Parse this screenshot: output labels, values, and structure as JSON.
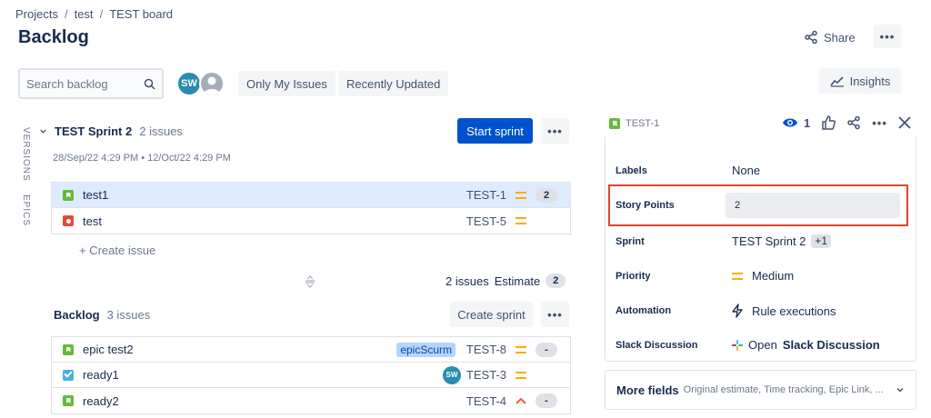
{
  "breadcrumb": [
    "Projects",
    "test",
    "TEST board"
  ],
  "page_title": "Backlog",
  "header": {
    "share_label": "Share",
    "more_label": "•••"
  },
  "toolbar": {
    "search_placeholder": "Search backlog",
    "avatar_initials": "SW",
    "filters": [
      "Only My Issues",
      "Recently Updated"
    ],
    "insights_label": "Insights"
  },
  "side_tabs": [
    "VERSIONS",
    "EPICS"
  ],
  "sprint": {
    "name": "TEST Sprint 2",
    "count": "2 issues",
    "dates": "28/Sep/22 4:29 PM • 12/Oct/22 4:29 PM",
    "start_label": "Start sprint",
    "issues": [
      {
        "summary": "test1",
        "key": "TEST-1",
        "type": "story",
        "priority": "medium",
        "estimate": "2",
        "selected": true
      },
      {
        "summary": "test",
        "key": "TEST-5",
        "type": "bug",
        "priority": "medium",
        "estimate": ""
      }
    ],
    "create_issue": "+ Create issue",
    "summary_count": "2 issues",
    "summary_estimate_label": "Estimate",
    "summary_estimate": "2"
  },
  "backlog": {
    "name": "Backlog",
    "count": "3 issues",
    "create_sprint_label": "Create sprint",
    "issues": [
      {
        "summary": "epic test2",
        "key": "TEST-8",
        "type": "story",
        "priority": "medium",
        "estimate": "-",
        "epic": "epicScurm"
      },
      {
        "summary": "ready1",
        "key": "TEST-3",
        "type": "task",
        "priority": "medium",
        "assignee": "SW"
      },
      {
        "summary": "ready2",
        "key": "TEST-4",
        "type": "story",
        "priority": "high",
        "estimate": "-"
      }
    ]
  },
  "detail": {
    "key": "TEST-1",
    "watchers": "1",
    "fields": {
      "labels": {
        "label": "Labels",
        "value": "None"
      },
      "story_points": {
        "label": "Story Points",
        "value": "2"
      },
      "sprint": {
        "label": "Sprint",
        "value": "TEST Sprint 2",
        "extra": "+1"
      },
      "priority": {
        "label": "Priority",
        "value": "Medium"
      },
      "automation": {
        "label": "Automation",
        "value": "Rule executions"
      },
      "slack": {
        "label": "Slack Discussion",
        "value_prefix": "Open",
        "value_strong": "Slack Discussion"
      }
    },
    "more_fields": {
      "label": "More fields",
      "sub": "Original estimate, Time tracking, Epic Link, ..."
    }
  },
  "colors": {
    "primary": "#0052cc",
    "story": "#63ba3c",
    "bug": "#e5493a",
    "task": "#4bade8",
    "priority_medium": "#ffab00",
    "priority_high": "#ff5630",
    "highlight": "#e0452b"
  }
}
